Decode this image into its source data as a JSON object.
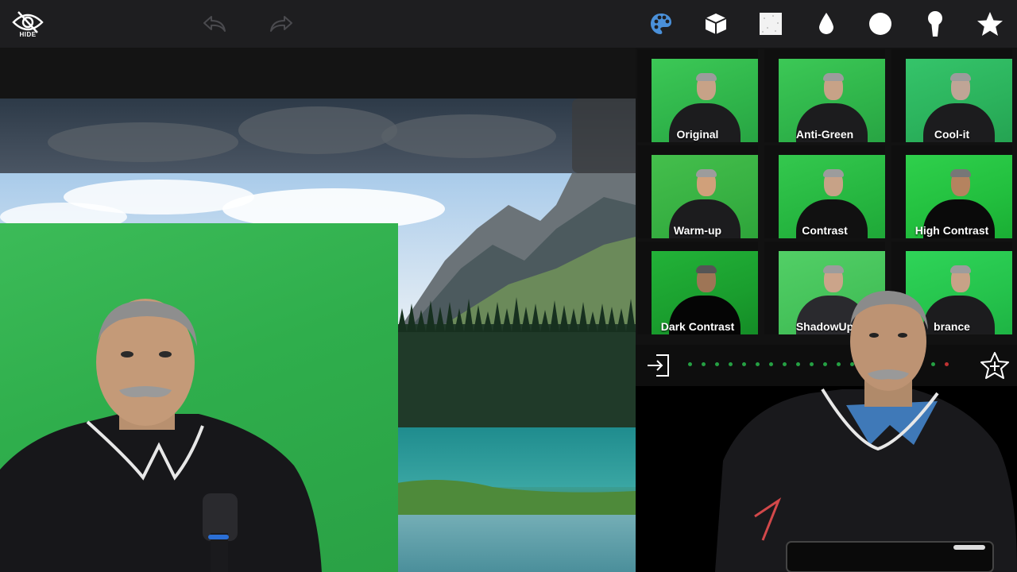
{
  "toolbar": {
    "hide_label": "HIDE",
    "tools": [
      {
        "name": "palette-icon",
        "color": "#4a90d9"
      },
      {
        "name": "cube-icon"
      },
      {
        "name": "texture-icon"
      },
      {
        "name": "drop-icon"
      },
      {
        "name": "circle-icon"
      },
      {
        "name": "keyhole-icon"
      },
      {
        "name": "star-icon"
      }
    ]
  },
  "effects": [
    {
      "label": "Original"
    },
    {
      "label": "Anti-Green"
    },
    {
      "label": "Cool-it"
    },
    {
      "label": "Warm-up"
    },
    {
      "label": "Contrast"
    },
    {
      "label": "High Contrast"
    },
    {
      "label": "Dark Contrast"
    },
    {
      "label": "ShadowUp"
    },
    {
      "label": "brance"
    }
  ],
  "colors": {
    "accent": "#4a90d9",
    "chroma_green": "#2fae4c"
  }
}
